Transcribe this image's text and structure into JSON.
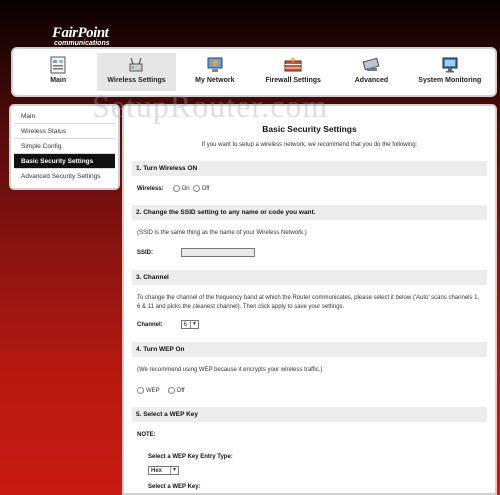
{
  "logo": {
    "line1": "FairPoint",
    "line2": "communications"
  },
  "watermark": "SetupRouter.com",
  "nav": [
    {
      "label": "Main",
      "icon": "tasks-icon"
    },
    {
      "label": "Wireless Settings",
      "icon": "wireless-icon"
    },
    {
      "label": "My Network",
      "icon": "network-icon"
    },
    {
      "label": "Firewall Settings",
      "icon": "firewall-icon"
    },
    {
      "label": "Advanced",
      "icon": "advanced-icon"
    },
    {
      "label": "System Monitoring",
      "icon": "monitor-icon"
    }
  ],
  "sidebar": [
    {
      "label": "Main"
    },
    {
      "label": "Wireless Status"
    },
    {
      "label": "Simple Config"
    },
    {
      "label": "Basic Security Settings"
    },
    {
      "label": "Advanced Security Settings"
    }
  ],
  "main": {
    "title": "Basic Security Settings",
    "intro": "If you want to setup a wireless network, we recommend that you do the following:",
    "s1": {
      "heading": "1. Turn Wireless ON",
      "label": "Wireless:",
      "on": "On",
      "off": "Off"
    },
    "s2": {
      "heading": "2. Change the SSID setting to any name or code you want.",
      "note": "(SSID is the same thing as the name of your Wireless Network.)",
      "label": "SSID:"
    },
    "s3": {
      "heading": "3. Channel",
      "text": "To change the channel of the frequency band at which the Router communicates, please select it below ('Auto' scans channels 1, 6 & 11 and picks the cleanest channel). Then click apply to save your settings.",
      "label": "Channel:",
      "value": "6"
    },
    "s4": {
      "heading": "4. Turn WEP On",
      "note": "(We recommend using WEP because it encrypts your wireless traffic.)",
      "wep": "WEP",
      "off": "Off"
    },
    "s5": {
      "heading": "5. Select a WEP Key",
      "note": "NOTE:",
      "entry_label": "Select a WEP Key Entry Type:",
      "entry_value": "Hex",
      "key_label": "Select a WEP Key:"
    }
  }
}
